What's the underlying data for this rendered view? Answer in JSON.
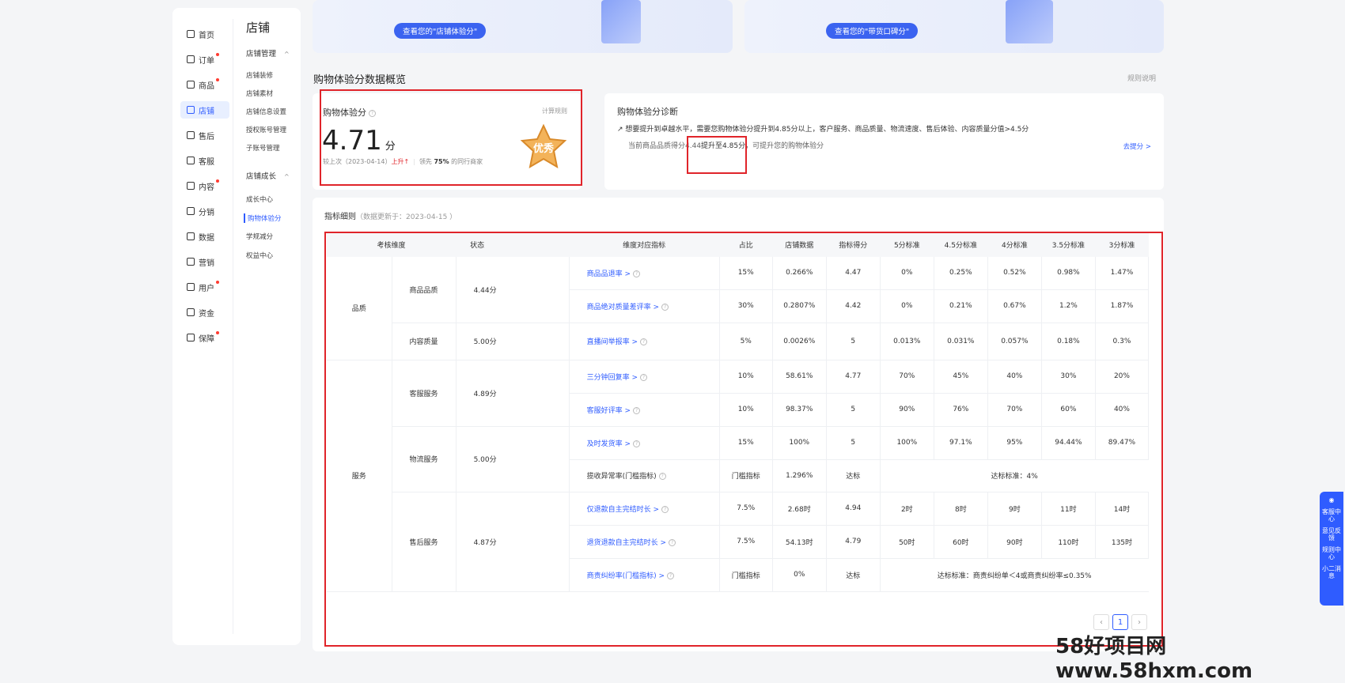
{
  "nav": {
    "items": [
      {
        "label": "首页",
        "dot": false
      },
      {
        "label": "订单",
        "dot": true
      },
      {
        "label": "商品",
        "dot": true
      },
      {
        "label": "店铺",
        "dot": false,
        "active": true
      },
      {
        "label": "售后",
        "dot": false
      },
      {
        "label": "客服",
        "dot": false
      },
      {
        "label": "内容",
        "dot": true
      },
      {
        "label": "分销",
        "dot": false
      },
      {
        "label": "数据",
        "dot": false
      },
      {
        "label": "营销",
        "dot": false
      },
      {
        "label": "用户",
        "dot": true
      },
      {
        "label": "资金",
        "dot": false
      },
      {
        "label": "保障",
        "dot": true
      }
    ],
    "sub_title": "店铺",
    "group1": "店铺管理",
    "group1_items": [
      "店铺装修",
      "店铺素材",
      "店铺信息设置",
      "授权账号管理",
      "子账号管理"
    ],
    "group2": "店铺成长",
    "group2_items": [
      "成长中心",
      "购物体验分",
      "学规减分",
      "权益中心"
    ]
  },
  "banners": [
    {
      "button": "查看您的\"店铺体验分\""
    },
    {
      "button": "查看您的\"带货口碑分\""
    }
  ],
  "overview": {
    "title": "购物体验分数据概览",
    "rules": "规则说明"
  },
  "score": {
    "label": "购物体验分",
    "calc": "计算规则",
    "value": "4.71",
    "unit": "分",
    "compare_prefix": "较上次（2023-04-14）",
    "trend": "上升",
    "lead_prefix": "领先",
    "lead_pct": "75%",
    "lead_suffix": "的同行商家",
    "badge": "优秀"
  },
  "diagnosis": {
    "title": "购物体验分诊断",
    "line1": "想要提升到卓越水平，需要您购物体验分提升到4.85分以上，客户服务、商品质量、物流速度、售后体验、内容质量分值>4.5分",
    "line2_a": "当前商品品质得分4.44",
    "line2_b": "提升至4.85分",
    "line2_c": "，可提升您的购物体验分",
    "action": "去提分 >"
  },
  "detail": {
    "title": "指标细则",
    "updated": "（数据更新于：2023-04-15 ）",
    "headers": [
      "考核维度",
      "状态",
      "维度对应指标",
      "占比",
      "店铺数据",
      "指标得分",
      "5分标准",
      "4.5分标准",
      "4分标准",
      "3.5分标准",
      "3分标准"
    ],
    "rows": [
      {
        "metric": "商品品退率 >",
        "link": true,
        "share": "15%",
        "store": "0.266%",
        "score": "4.47",
        "s5": "0%",
        "s45": "0.25%",
        "s4": "0.52%",
        "s35": "0.98%",
        "s3": "1.47%"
      },
      {
        "metric": "商品绝对质量差评率 >",
        "link": true,
        "share": "30%",
        "store": "0.2807%",
        "score": "4.42",
        "s5": "0%",
        "s45": "0.21%",
        "s4": "0.67%",
        "s35": "1.2%",
        "s3": "1.87%"
      },
      {
        "metric": "直播间举报率 >",
        "link": true,
        "share": "5%",
        "store": "0.0026%",
        "score": "5",
        "s5": "0.013%",
        "s45": "0.031%",
        "s4": "0.057%",
        "s35": "0.18%",
        "s3": "0.3%"
      },
      {
        "metric": "三分钟回复率 >",
        "link": true,
        "share": "10%",
        "store": "58.61%",
        "score": "4.77",
        "s5": "70%",
        "s45": "45%",
        "s4": "40%",
        "s35": "30%",
        "s3": "20%"
      },
      {
        "metric": "客服好评率 >",
        "link": true,
        "share": "10%",
        "store": "98.37%",
        "score": "5",
        "s5": "90%",
        "s45": "76%",
        "s4": "70%",
        "s35": "60%",
        "s3": "40%"
      },
      {
        "metric": "及时发货率 >",
        "link": true,
        "share": "15%",
        "store": "100%",
        "score": "5",
        "s5": "100%",
        "s45": "97.1%",
        "s4": "95%",
        "s35": "94.44%",
        "s3": "89.47%"
      },
      {
        "metric": "揽收异常率(门槛指标)",
        "link": false,
        "share": "门槛指标",
        "store": "1.296%",
        "score": "达标",
        "merged": "达标标准：4%"
      },
      {
        "metric": "仅退款自主完结时长 >",
        "link": true,
        "share": "7.5%",
        "store": "2.68时",
        "score": "4.94",
        "s5": "2时",
        "s45": "8时",
        "s4": "9时",
        "s35": "11时",
        "s3": "14时"
      },
      {
        "metric": "退货退款自主完结时长 >",
        "link": true,
        "share": "7.5%",
        "store": "54.13时",
        "score": "4.79",
        "s5": "50时",
        "s45": "60时",
        "s4": "90时",
        "s35": "110时",
        "s3": "135时"
      },
      {
        "metric": "商责纠纷率(门槛指标) >",
        "link": true,
        "share": "门槛指标",
        "store": "0%",
        "score": "达标",
        "merged": "达标标准：商责纠纷单＜4或商责纠纷率≤0.35%"
      }
    ],
    "dims": {
      "quality": "品质",
      "service": "服务"
    },
    "subdims": [
      {
        "name": "商品品质",
        "status": "4.44分"
      },
      {
        "name": "内容质量",
        "status": "5.00分"
      },
      {
        "name": "客服服务",
        "status": "4.89分"
      },
      {
        "name": "物流服务",
        "status": "5.00分"
      },
      {
        "name": "售后服务",
        "status": "4.87分"
      }
    ],
    "page": "1"
  },
  "float": [
    "客服中心",
    "意见反馈",
    "规则中心",
    "小二消息"
  ],
  "watermark": "58好项目网www.58hxm.com"
}
